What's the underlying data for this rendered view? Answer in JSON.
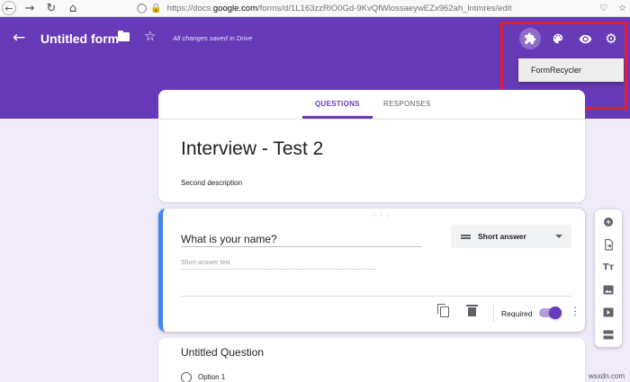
{
  "browser": {
    "url_prefix": "https://docs.",
    "url_domain": "google.com",
    "url_rest": "/forms/d/1L163zzRlO0Gd-9KvQfWlossaeywEZx962ah_lntmres/edit",
    "icons": [
      "back-icon",
      "forward-icon",
      "reload-icon",
      "home-icon",
      "shield-icon",
      "lock-icon",
      "pocket-icon",
      "bookmark-star-icon"
    ]
  },
  "header": {
    "form_title": "Untitled form",
    "save_status": "All changes saved in Drive",
    "color": "#673ab7"
  },
  "addon_menu": {
    "items": [
      "FormRecycler"
    ]
  },
  "tabs": [
    {
      "label": "QUESTIONS",
      "active": true
    },
    {
      "label": "RESPONSES",
      "active": false
    }
  ],
  "form": {
    "title": "Interview - Test 2",
    "description": "Second description"
  },
  "question1": {
    "title": "What is your name?",
    "type": "Short answer",
    "placeholder": "Short-answer text",
    "required_label": "Required",
    "required": true
  },
  "question2": {
    "title": "Untitled Question",
    "option1": "Option 1"
  },
  "toolbar": {
    "icons": [
      "add-question-icon",
      "import-questions-icon",
      "add-title-icon",
      "add-image-icon",
      "add-video-icon",
      "add-section-icon"
    ]
  },
  "watermark": "wsxdn.com",
  "colors": {
    "accent": "#673ab7",
    "highlight_box": "#e21d3a",
    "active_border": "#4285f4"
  }
}
